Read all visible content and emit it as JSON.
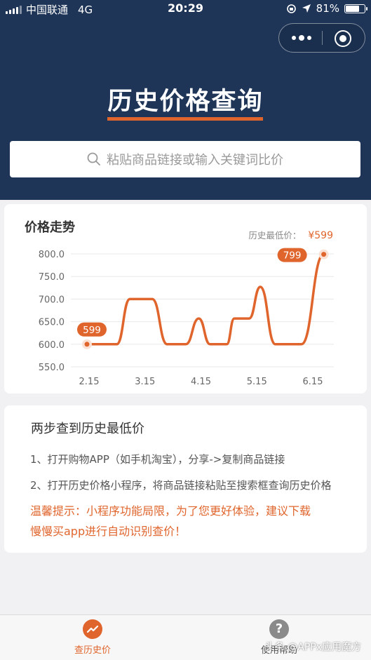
{
  "status_bar": {
    "carrier": "中国联通",
    "network": "4G",
    "time": "20:29",
    "battery": "81%",
    "battery_level": 0.81
  },
  "header": {
    "title": "历史价格查询"
  },
  "search": {
    "placeholder": "粘贴商品链接或输入关键词比价"
  },
  "chart_card": {
    "title": "价格走势",
    "lowest_label": "历史最低价：",
    "lowest_price": "¥599"
  },
  "chart_data": {
    "type": "line",
    "x_ticks": [
      "2.15",
      "3.15",
      "4.15",
      "5.15",
      "6.15"
    ],
    "y_ticks": [
      "800.0",
      "750.0",
      "700.0",
      "650.0",
      "600.0",
      "550.0"
    ],
    "ylim": [
      550,
      800
    ],
    "points": [
      {
        "x": "2.15",
        "y": 600
      },
      {
        "x": "3.01",
        "y": 600
      },
      {
        "x": "3.08",
        "y": 700
      },
      {
        "x": "3.20",
        "y": 700
      },
      {
        "x": "3.28",
        "y": 600
      },
      {
        "x": "4.08",
        "y": 600
      },
      {
        "x": "4.15",
        "y": 657
      },
      {
        "x": "4.21",
        "y": 600
      },
      {
        "x": "4.30",
        "y": 600
      },
      {
        "x": "5.04",
        "y": 657
      },
      {
        "x": "5.12",
        "y": 657
      },
      {
        "x": "5.18",
        "y": 727
      },
      {
        "x": "5.26",
        "y": 600
      },
      {
        "x": "6.10",
        "y": 600
      },
      {
        "x": "6.22",
        "y": 799
      }
    ],
    "start_label": "599",
    "end_label": "799",
    "colors": {
      "line": "#e0652d",
      "grid": "#e8e8e8",
      "axis_text": "#666666"
    }
  },
  "info": {
    "title": "两步查到历史最低价",
    "step1": "1、打开购物APP（如手机淘宝），分享->复制商品链接",
    "step2": "2、打开历史价格小程序，将商品链接粘贴至搜索框查询历史价格",
    "tip_line1": "温馨提示：小程序功能局限，为了您更好体验，建议下载",
    "tip_line2": "慢慢买app进行自动识别查价！"
  },
  "tabbar": {
    "tab1_label": "查历史价",
    "tab2_label": "使用帮助",
    "tab2_icon_text": "?"
  },
  "watermark": "头条 @APPx应用魔方",
  "colors": {
    "header_bg": "#1e3558",
    "accent": "#e0652d"
  }
}
